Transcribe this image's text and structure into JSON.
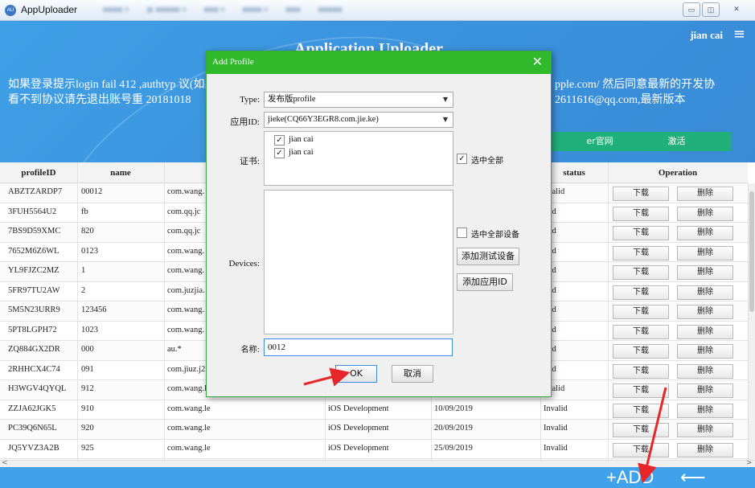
{
  "window": {
    "app_icon_text": "AU",
    "title": "AppUploader",
    "menus": [
      "■■■■ ▾",
      "◉ ■■■■■ ▾",
      "■■■ ▾",
      "■■■■ ▾",
      "■■■",
      "■■■■■"
    ],
    "minimize": "▭",
    "restore": "◫",
    "close": "✕"
  },
  "header": {
    "user": "jian cai",
    "menu_icon": "≡",
    "app_title": "Application Uploader",
    "notice_left": "如果登录提示login fail 412 ,authtyp 议(如果看不到协议请先退出账号重 20181018",
    "notice_right": "pple.com/ 然后同意最新的开发协 2611616@qq.com,最新版本",
    "btn_developer": "er官网",
    "btn_activate": "激活"
  },
  "table": {
    "columns": [
      "profileID",
      "name",
      "",
      "",
      "",
      "status",
      "Operation"
    ],
    "download_label": "下载",
    "delete_label": "删除",
    "rows": [
      {
        "id": "ABZTZARDP7",
        "name": "00012",
        "bundle": "com.wang.",
        "type": "",
        "date": "",
        "status": "nvalid"
      },
      {
        "id": "3FUH5564U2",
        "name": "fb",
        "bundle": "com.qq.jc",
        "type": "",
        "date": "",
        "status": "alid"
      },
      {
        "id": "7BS9D59XMC",
        "name": "820",
        "bundle": "com.qq.jc",
        "type": "",
        "date": "",
        "status": "alid"
      },
      {
        "id": "7652M6Z6WL",
        "name": "0123",
        "bundle": "com.wang.",
        "type": "",
        "date": "",
        "status": "alid"
      },
      {
        "id": "YL9FJZC2MZ",
        "name": "1",
        "bundle": "com.wang.",
        "type": "",
        "date": "",
        "status": "alid"
      },
      {
        "id": "5FR97TU2AW",
        "name": "2",
        "bundle": "com.juzjia.",
        "type": "",
        "date": "",
        "status": "alid"
      },
      {
        "id": "5M5N23URR9",
        "name": "123456",
        "bundle": "com.wang.",
        "type": "",
        "date": "",
        "status": "alid"
      },
      {
        "id": "5PT8LGPH72",
        "name": "1023",
        "bundle": "com.wang.",
        "type": "",
        "date": "",
        "status": "alid"
      },
      {
        "id": "ZQ884GX2DR",
        "name": "000",
        "bundle": "au.*",
        "type": "",
        "date": "",
        "status": "alid"
      },
      {
        "id": "2RHHCX4C74",
        "name": "091",
        "bundle": "com.jiuz.j2",
        "type": "",
        "date": "",
        "status": "alid"
      },
      {
        "id": "H3WGV4QYQL",
        "name": "912",
        "bundle": "com.wang.le",
        "type": "iOS Development",
        "date": "10/09/2019",
        "status": "nvalid"
      },
      {
        "id": "ZZJA62JGK5",
        "name": "910",
        "bundle": "com.wang.le",
        "type": "iOS Development",
        "date": "10/09/2019",
        "status": "Invalid"
      },
      {
        "id": "PC39Q6N65L",
        "name": "920",
        "bundle": "com.wang.le",
        "type": "iOS Development",
        "date": "20/09/2019",
        "status": "Invalid"
      },
      {
        "id": "JQ5YVZ3A2B",
        "name": "925",
        "bundle": "com.wang.le",
        "type": "iOS Development",
        "date": "25/09/2019",
        "status": "Invalid"
      }
    ]
  },
  "footer": {
    "add": "+ADD",
    "back": "⟵ BACK"
  },
  "dialog": {
    "title": "Add Profile",
    "close": "✕",
    "type_label": "Type:",
    "type_value": "发布版profile",
    "appid_label": "应用ID:",
    "appid_value": "jieke(CQ66Y3EGR8.com.jie.ke)",
    "cert_label": "证书:",
    "certs": [
      "jian cai",
      "jian cai"
    ],
    "select_all": "选中全部",
    "devices_label": "Devices:",
    "select_all_devices": "选中全部设备",
    "add_test_device": "添加测试设备",
    "add_app_id": "添加应用ID",
    "name_label": "名称:",
    "name_value": "0012",
    "ok": "OK",
    "cancel": "取消"
  },
  "colors": {
    "header_blue": "#3b93dd",
    "dialog_green": "#2fb92b",
    "button_green": "#21b07b",
    "arrow_red": "#e8262a"
  }
}
